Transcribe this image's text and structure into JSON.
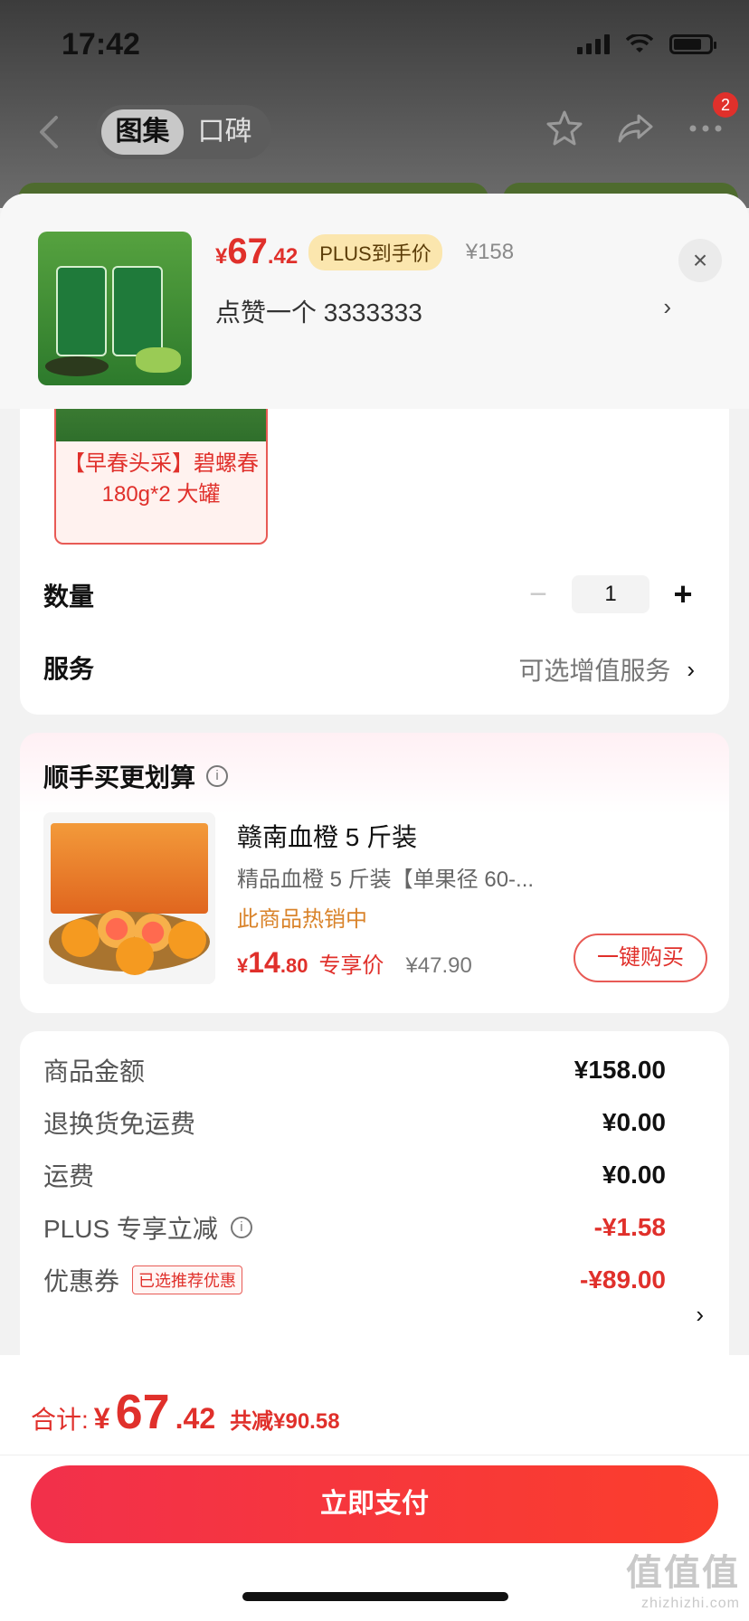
{
  "status_bar": {
    "time": "17:42"
  },
  "nav": {
    "tabs": [
      {
        "label": "图集",
        "active": true
      },
      {
        "label": "口碑",
        "active": false
      }
    ],
    "badge_count": "2"
  },
  "selected_sku": {
    "price_currency": "¥",
    "price_int": "67",
    "price_dec": ".42",
    "plus_tag": "PLUS到手价",
    "original_price": "¥158",
    "name": "点赞一个  3333333",
    "arrow": "›",
    "close": "×"
  },
  "sku_option": {
    "label_line1": "【早春头采】碧螺春",
    "label_line2": "180g*2 大罐"
  },
  "quantity": {
    "label": "数量",
    "minus": "−",
    "value": "1",
    "plus": "+"
  },
  "service": {
    "label": "服务",
    "value": "可选增值服务",
    "arrow": "›"
  },
  "addon": {
    "title": "顺手买更划算",
    "info": "i",
    "name": "赣南血橙 5 斤装",
    "desc": "精品血橙 5 斤装【单果径 60-...",
    "hot": "此商品热销中",
    "price_currency": "¥",
    "price_int": "14",
    "price_dec": ".80",
    "price_label": "专享价",
    "original_price": "¥47.90",
    "button": "一键购买"
  },
  "summary": {
    "rows": [
      {
        "label": "商品金额",
        "value": "¥158.00"
      },
      {
        "label": "退换货免运费",
        "value": "¥0.00"
      },
      {
        "label": "运费",
        "value": "¥0.00"
      },
      {
        "label": "PLUS 专享立减",
        "value": "-¥1.58"
      },
      {
        "label": "优惠券",
        "value": "-¥89.00",
        "tag": "已选推荐优惠"
      }
    ],
    "info": "i",
    "arrow": "›"
  },
  "bottom": {
    "total_label": "合计:",
    "total_currency": "¥",
    "total_int": "67",
    "total_dec": ".42",
    "saved": "共减¥90.58",
    "pay_button": "立即支付"
  },
  "watermark": {
    "main": "值值值",
    "sub": "zhizhizhi.com"
  },
  "colors": {
    "accent_red": "#e0302b",
    "plus_gold": "#fbe6ae",
    "hot_orange": "#d9832a"
  }
}
